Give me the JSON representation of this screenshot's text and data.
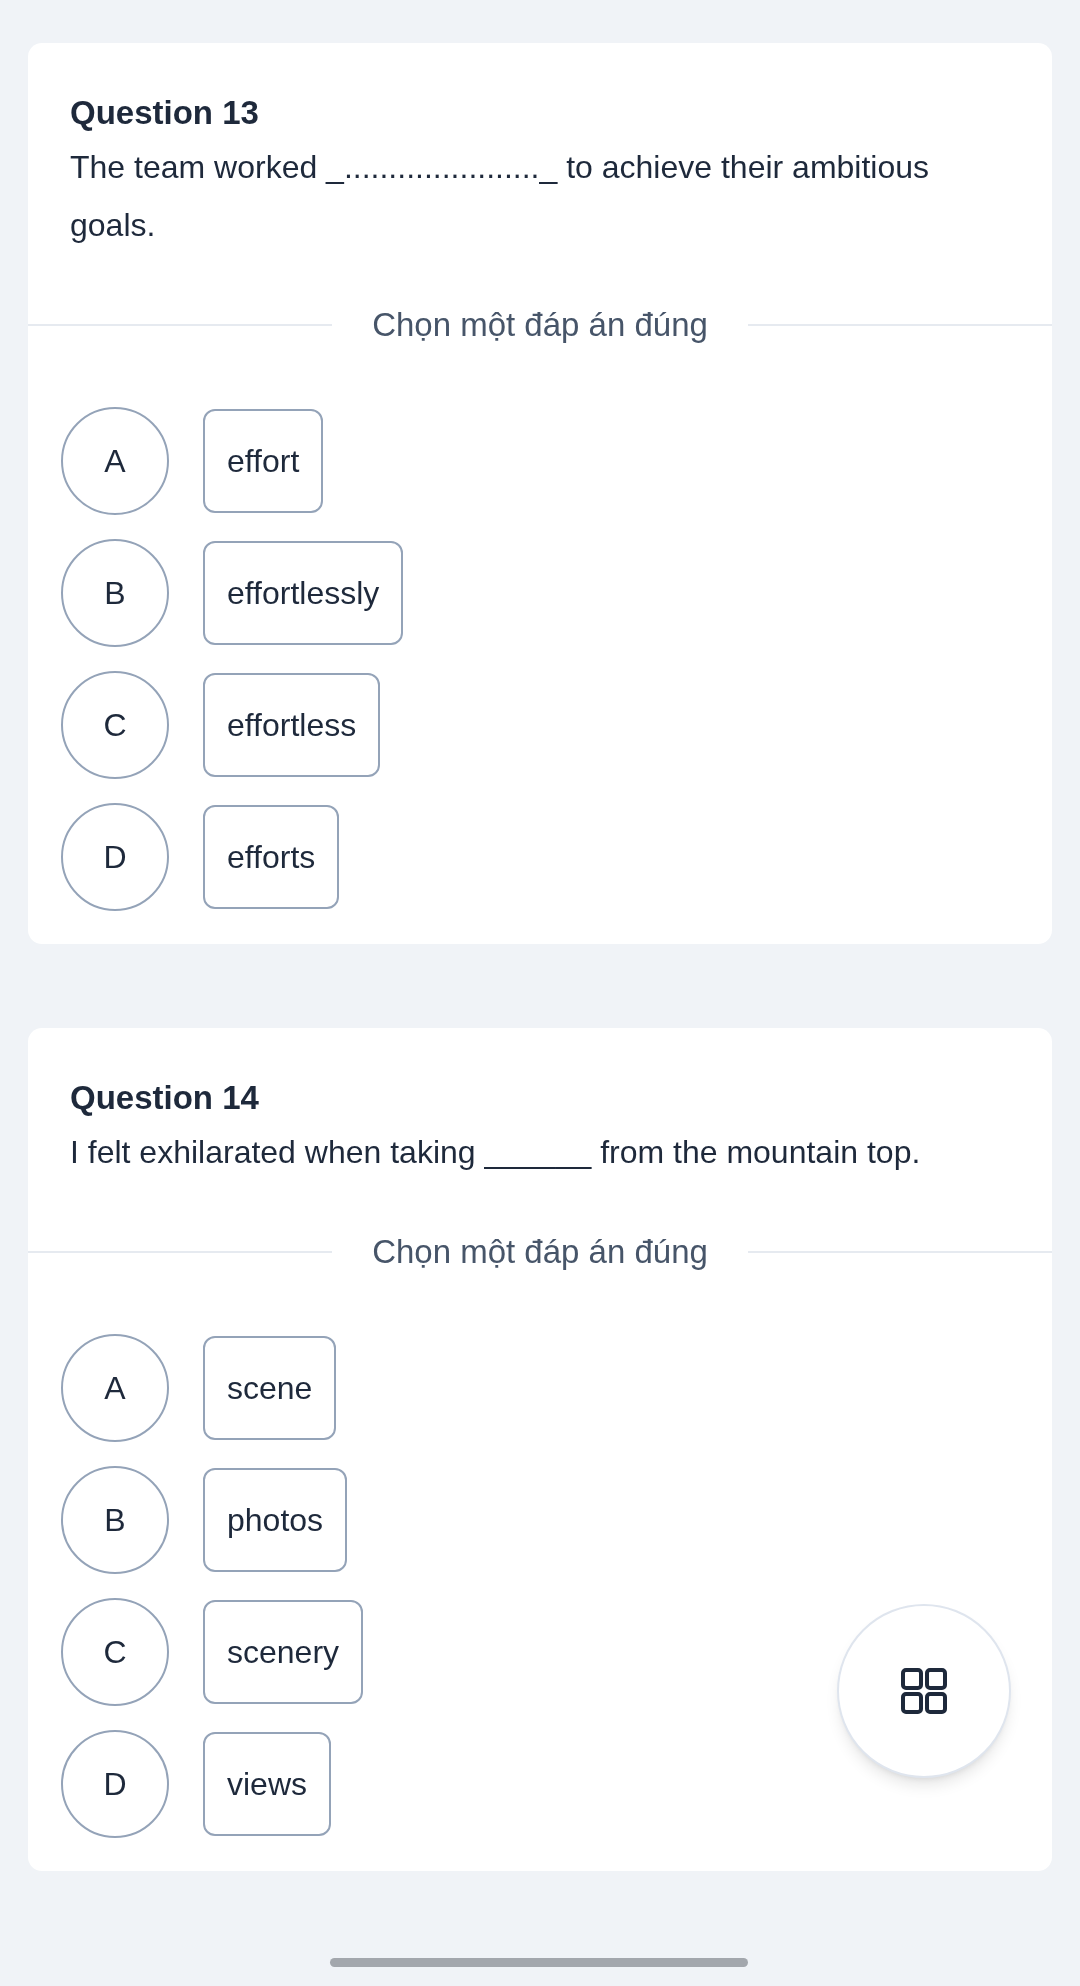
{
  "questions": [
    {
      "title": "Question 13",
      "text": "The team worked _......................_ to achieve their ambitious goals.",
      "prompt": "Chọn một đáp án đúng",
      "options": [
        {
          "letter": "A",
          "text": "effort"
        },
        {
          "letter": "B",
          "text": "effortlessly"
        },
        {
          "letter": "C",
          "text": "effortless"
        },
        {
          "letter": "D",
          "text": "efforts"
        }
      ]
    },
    {
      "title": "Question 14",
      "text": "I felt exhilarated when taking ______ from the mountain top.",
      "prompt": "Chọn một đáp án đúng",
      "options": [
        {
          "letter": "A",
          "text": "scene"
        },
        {
          "letter": "B",
          "text": "photos"
        },
        {
          "letter": "C",
          "text": "scenery"
        },
        {
          "letter": "D",
          "text": "views"
        }
      ]
    }
  ]
}
